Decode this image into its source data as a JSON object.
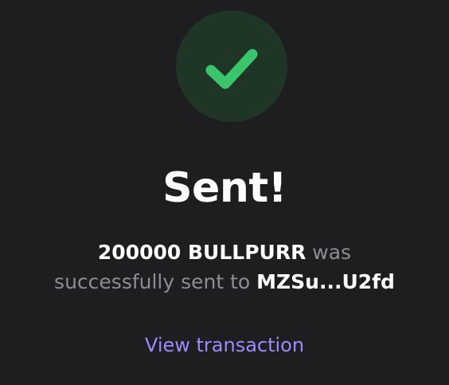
{
  "status_icon": "checkmark-icon",
  "colors": {
    "background": "#1e1e20",
    "check_circle_bg": "#1f3526",
    "check_color": "#3ac46b",
    "link_color": "#9c8aff",
    "muted_text": "#8c8c93"
  },
  "title": "Sent!",
  "message": {
    "amount_token": "200000 BULLPURR",
    "middle_text": " was successfully sent to ",
    "recipient": "MZSu...U2fd"
  },
  "view_transaction_label": "View transaction"
}
